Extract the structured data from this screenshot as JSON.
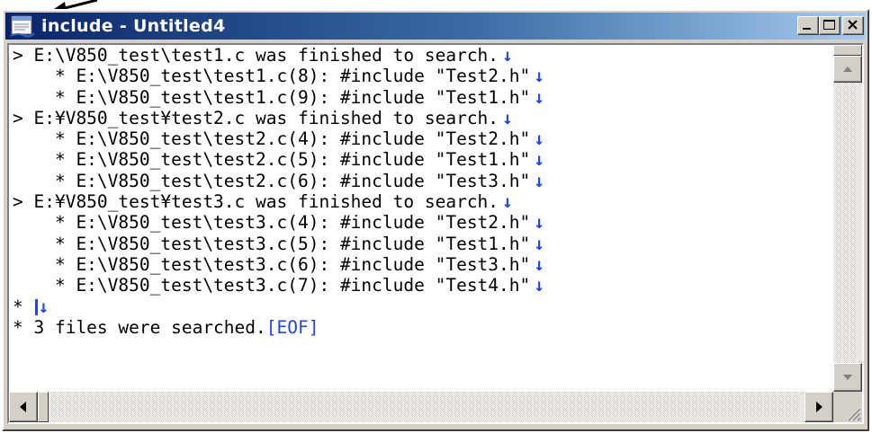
{
  "window": {
    "title": "include - Untitled4",
    "title_bar_color": "#0a246a",
    "buttons": [
      "minimize-icon",
      "maximize-icon",
      "close-icon"
    ]
  },
  "output": {
    "lines": [
      "> E:\\V850_test\\test1.c was finished to search.",
      "    * E:\\V850_test\\test1.c(8): #include \"Test2.h\"",
      "    * E:\\V850_test\\test1.c(9): #include \"Test1.h\"",
      "> E:¥V850_test¥test2.c was finished to search.",
      "    * E:\\V850_test\\test2.c(4): #include \"Test2.h\"",
      "    * E:\\V850_test\\test2.c(5): #include \"Test1.h\"",
      "    * E:\\V850_test\\test2.c(6): #include \"Test3.h\"",
      "> E:¥V850_test¥test3.c was finished to search.",
      "    * E:\\V850_test\\test3.c(4): #include \"Test2.h\"",
      "    * E:\\V850_test\\test3.c(5): #include \"Test1.h\"",
      "    * E:\\V850_test\\test3.c(6): #include \"Test3.h\"",
      "    * E:\\V850_test\\test3.c(7): #include \"Test4.h\"",
      "* ",
      "* 3 files were searched."
    ],
    "newline_glyph": "↓",
    "eof_marker": "[EOF]",
    "marker_color": "#2244ee"
  }
}
